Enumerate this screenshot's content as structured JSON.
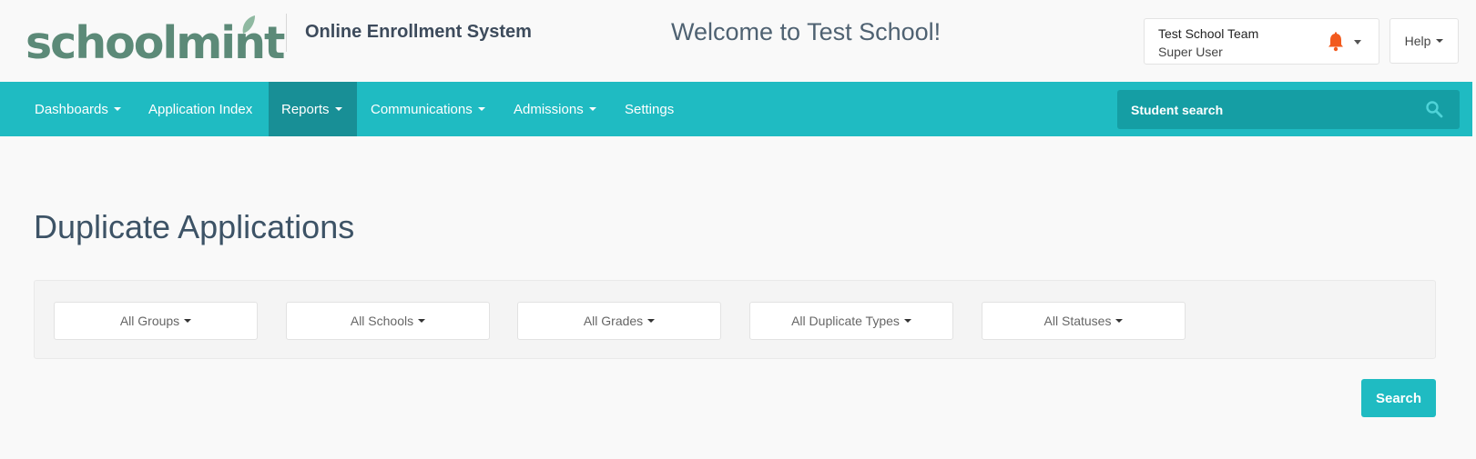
{
  "header": {
    "logo_text": "schoolmint",
    "subtitle": "Online Enrollment System",
    "welcome": "Welcome to Test School!",
    "user": {
      "name": "Test School Team",
      "role": "Super User"
    },
    "help_label": "Help"
  },
  "nav": {
    "items": [
      {
        "label": "Dashboards",
        "dropdown": true
      },
      {
        "label": "Application Index",
        "dropdown": false
      },
      {
        "label": "Reports",
        "dropdown": true,
        "active": true
      },
      {
        "label": "Communications",
        "dropdown": true
      },
      {
        "label": "Admissions",
        "dropdown": true
      },
      {
        "label": "Settings",
        "dropdown": false
      }
    ],
    "search_placeholder": "Student search"
  },
  "main": {
    "title": "Duplicate Applications",
    "filters": [
      {
        "label": "All Groups"
      },
      {
        "label": "All Schools"
      },
      {
        "label": "All Grades"
      },
      {
        "label": "All Duplicate Types"
      },
      {
        "label": "All Statuses"
      }
    ],
    "search_button": "Search"
  },
  "colors": {
    "accent": "#1fbbc2",
    "nav_active": "#188f96",
    "logo": "#5c8a78",
    "bell": "#f25a1d"
  },
  "icons": [
    "leaf-icon",
    "bell-icon",
    "search-icon",
    "caret-down-icon"
  ]
}
